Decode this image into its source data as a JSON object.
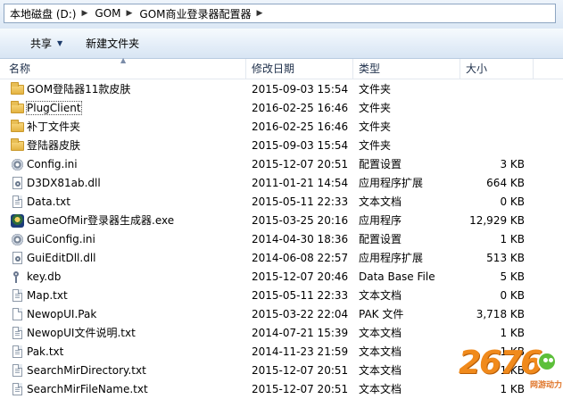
{
  "address": {
    "crumbs": [
      "本地磁盘 (D:)",
      "GOM",
      "GOM商业登录器配置器"
    ]
  },
  "toolbar": {
    "share_label": "共享",
    "newfolder_label": "新建文件夹"
  },
  "columns": {
    "name": "名称",
    "date": "修改日期",
    "type": "类型",
    "size": "大小"
  },
  "files": [
    {
      "icon": "folder",
      "name": "GOM登陆器11款皮肤",
      "date": "2015-09-03 15:54",
      "type": "文件夹",
      "size": ""
    },
    {
      "icon": "folder",
      "name": "PlugClient",
      "date": "2016-02-25 16:46",
      "type": "文件夹",
      "size": ""
    },
    {
      "icon": "folder",
      "name": "补丁文件夹",
      "date": "2016-02-25 16:46",
      "type": "文件夹",
      "size": ""
    },
    {
      "icon": "folder",
      "name": "登陆器皮肤",
      "date": "2015-09-03 15:54",
      "type": "文件夹",
      "size": ""
    },
    {
      "icon": "config",
      "name": "Config.ini",
      "date": "2015-12-07 20:51",
      "type": "配置设置",
      "size": "3 KB"
    },
    {
      "icon": "dll",
      "name": "D3DX81ab.dll",
      "date": "2011-01-21 14:54",
      "type": "应用程序扩展",
      "size": "664 KB"
    },
    {
      "icon": "txt",
      "name": "Data.txt",
      "date": "2015-05-11 22:33",
      "type": "文本文档",
      "size": "0 KB"
    },
    {
      "icon": "exe",
      "name": "GameOfMir登录器生成器.exe",
      "date": "2015-03-25 20:16",
      "type": "应用程序",
      "size": "12,929 KB"
    },
    {
      "icon": "config",
      "name": "GuiConfig.ini",
      "date": "2014-04-30 18:36",
      "type": "配置设置",
      "size": "1 KB"
    },
    {
      "icon": "dll",
      "name": "GuiEditDll.dll",
      "date": "2014-06-08 22:57",
      "type": "应用程序扩展",
      "size": "513 KB"
    },
    {
      "icon": "key",
      "name": "key.db",
      "date": "2015-12-07 20:46",
      "type": "Data Base File",
      "size": "5 KB"
    },
    {
      "icon": "txt",
      "name": "Map.txt",
      "date": "2015-05-11 22:33",
      "type": "文本文档",
      "size": "0 KB"
    },
    {
      "icon": "file",
      "name": "NewopUI.Pak",
      "date": "2015-03-22 22:04",
      "type": "PAK 文件",
      "size": "3,718 KB"
    },
    {
      "icon": "txt",
      "name": "NewopUI文件说明.txt",
      "date": "2014-07-21 15:39",
      "type": "文本文档",
      "size": "1 KB"
    },
    {
      "icon": "txt",
      "name": "Pak.txt",
      "date": "2014-11-23 21:59",
      "type": "文本文档",
      "size": "1 KB"
    },
    {
      "icon": "txt",
      "name": "SearchMirDirectory.txt",
      "date": "2015-12-07 20:51",
      "type": "文本文档",
      "size": "1 KB"
    },
    {
      "icon": "txt",
      "name": "SearchMirFileName.txt",
      "date": "2015-12-07 20:51",
      "type": "文本文档",
      "size": "1 KB"
    }
  ],
  "watermark": {
    "digits": "2676",
    "sub": "网游动力"
  }
}
